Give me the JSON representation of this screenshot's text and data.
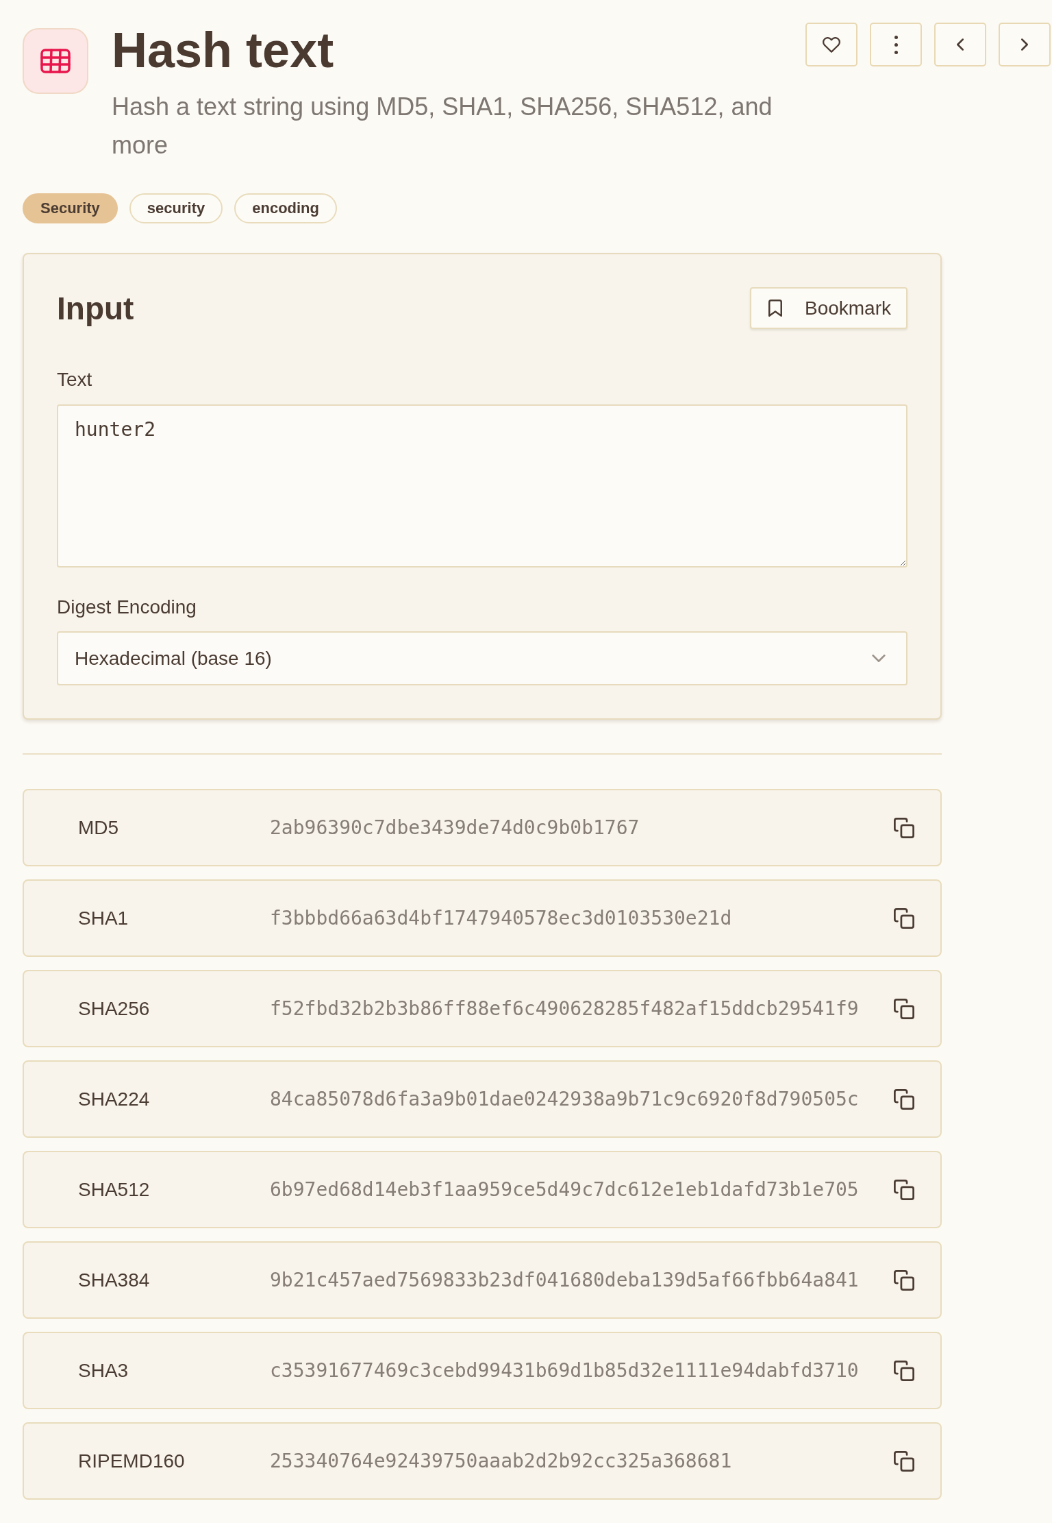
{
  "header": {
    "title": "Hash text",
    "description": "Hash a text string using MD5, SHA1, SHA256, SHA512, and more"
  },
  "tags": [
    {
      "label": "Security",
      "kind": "category"
    },
    {
      "label": "security",
      "kind": "keyword"
    },
    {
      "label": "encoding",
      "kind": "keyword"
    }
  ],
  "input_card": {
    "title": "Input",
    "bookmark_button": "Bookmark",
    "fields": [
      {
        "kind": "textarea",
        "label": "Text",
        "value": "hunter2"
      },
      {
        "kind": "select",
        "label": "Digest Encoding",
        "value": "Hexadecimal (base 16)"
      }
    ]
  },
  "results": [
    {
      "algorithm": "MD5",
      "digest": "2ab96390c7dbe3439de74d0c9b0b1767"
    },
    {
      "algorithm": "SHA1",
      "digest": "f3bbbd66a63d4bf1747940578ec3d0103530e21d"
    },
    {
      "algorithm": "SHA256",
      "digest": "f52fbd32b2b3b86ff88ef6c490628285f482af15ddcb29541f9"
    },
    {
      "algorithm": "SHA224",
      "digest": "84ca85078d6fa3a9b01dae0242938a9b71c9c6920f8d790505c"
    },
    {
      "algorithm": "SHA512",
      "digest": "6b97ed68d14eb3f1aa959ce5d49c7dc612e1eb1dafd73b1e705"
    },
    {
      "algorithm": "SHA384",
      "digest": "9b21c457aed7569833b23df041680deba139d5af66fbb64a841"
    },
    {
      "algorithm": "SHA3",
      "digest": "c35391677469c3cebd99431b69d1b85d32e1111e94dabfd3710"
    },
    {
      "algorithm": "RIPEMD160",
      "digest": "253340764e92439750aaab2d2b92cc325a368681"
    }
  ]
}
